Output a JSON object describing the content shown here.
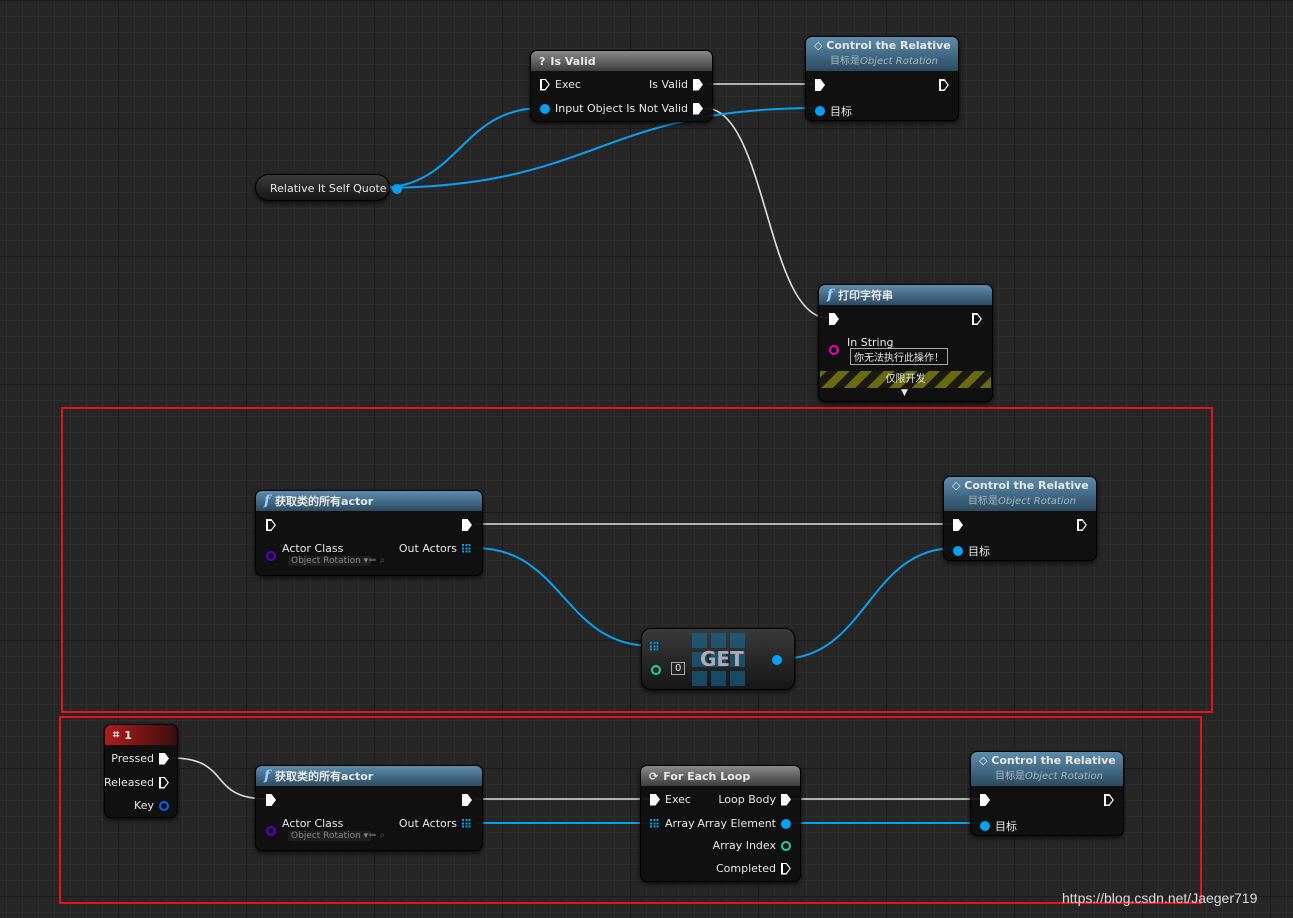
{
  "nodes": {
    "is_valid": {
      "title": "Is Valid",
      "icon": "question-icon",
      "pins": {
        "exec": "Exec",
        "input_object": "Input Object",
        "is_valid": "Is Valid",
        "is_not_valid": "Is Not Valid"
      }
    },
    "control_1": {
      "title": "Control the Relative",
      "subtitle_prefix": "目标是",
      "subtitle_target": "Object Rotation",
      "target": "目标"
    },
    "variable": {
      "label": "Relative It Self Quote"
    },
    "print_string": {
      "title": "打印字符串",
      "in_string_label": "In String",
      "in_string_value": "你无法执行此操作！",
      "dev_only": "仅限开发"
    },
    "get_all_1": {
      "title": "获取类的所有actor",
      "actor_class": "Actor Class",
      "class_value": "Object Rotation",
      "out_actors": "Out Actors"
    },
    "control_2": {
      "title": "Control the Relative",
      "subtitle_prefix": "目标是",
      "subtitle_target": "Object Rotation",
      "target": "目标"
    },
    "get": {
      "label": "GET",
      "index": "0"
    },
    "key_event": {
      "title": "1",
      "pressed": "Pressed",
      "released": "Released",
      "key": "Key"
    },
    "get_all_2": {
      "title": "获取类的所有actor",
      "actor_class": "Actor Class",
      "class_value": "Object Rotation",
      "out_actors": "Out Actors"
    },
    "for_each": {
      "title": "For Each Loop",
      "exec": "Exec",
      "array": "Array",
      "loop_body": "Loop Body",
      "array_element": "Array Element",
      "array_index": "Array Index",
      "completed": "Completed"
    },
    "control_3": {
      "title": "Control the Relative",
      "subtitle_prefix": "目标是",
      "subtitle_target": "Object Rotation",
      "target": "目标"
    }
  },
  "colors": {
    "exec_wire": "#e0e0e0",
    "object_wire": "#0aa0f0",
    "highlight_box": "#e5131d",
    "string_pin": "#f000c0",
    "class_pin": "#5a00c8",
    "int_pin": "#1fd39a"
  },
  "watermark": "https://blog.csdn.net/Jaeger719"
}
